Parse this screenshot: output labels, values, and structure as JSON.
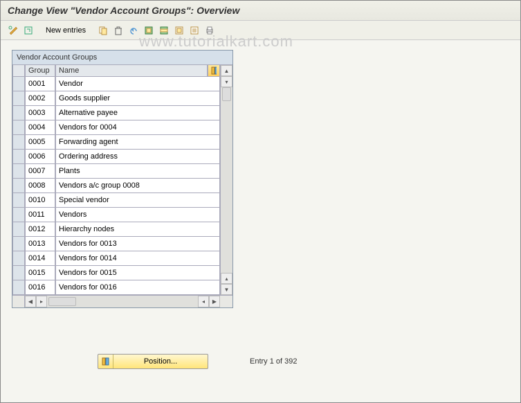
{
  "title": "Change View \"Vendor Account Groups\": Overview",
  "toolbar": {
    "new_entries_label": "New entries"
  },
  "watermark": "www.tutorialkart.com",
  "table": {
    "title": "Vendor Account Groups",
    "columns": {
      "group": "Group",
      "name": "Name"
    },
    "rows": [
      {
        "group": "0001",
        "name": "Vendor"
      },
      {
        "group": "0002",
        "name": "Goods supplier"
      },
      {
        "group": "0003",
        "name": "Alternative payee"
      },
      {
        "group": "0004",
        "name": "Vendors for 0004"
      },
      {
        "group": "0005",
        "name": "Forwarding agent"
      },
      {
        "group": "0006",
        "name": "Ordering address"
      },
      {
        "group": "0007",
        "name": "Plants"
      },
      {
        "group": "0008",
        "name": "Vendors  a/c group 0008"
      },
      {
        "group": "0010",
        "name": "Special vendor"
      },
      {
        "group": "0011",
        "name": "Vendors"
      },
      {
        "group": "0012",
        "name": "Hierarchy nodes"
      },
      {
        "group": "0013",
        "name": "Vendors for 0013"
      },
      {
        "group": "0014",
        "name": "Vendors for 0014"
      },
      {
        "group": "0015",
        "name": "Vendors for 0015"
      },
      {
        "group": "0016",
        "name": "Vendors for 0016"
      }
    ]
  },
  "footer": {
    "position_label": "Position...",
    "entry_text": "Entry 1 of 392"
  }
}
